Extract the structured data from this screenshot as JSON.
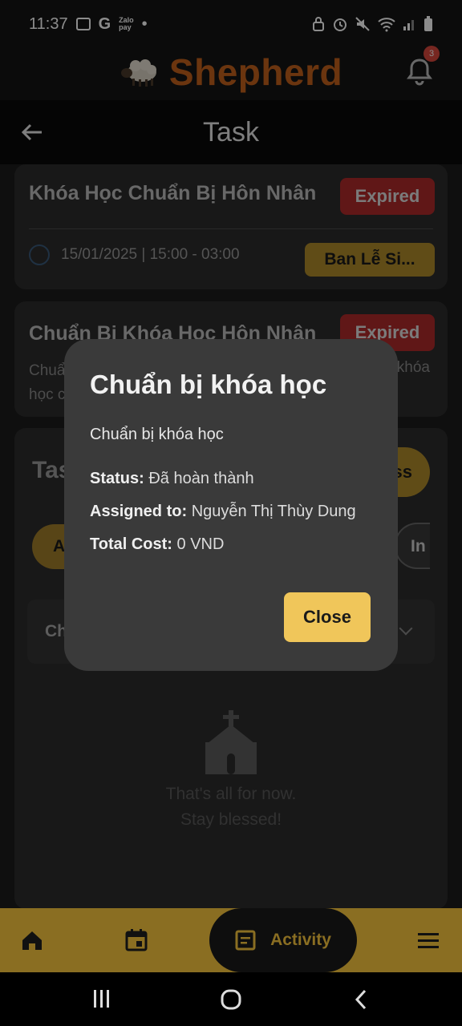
{
  "status_bar": {
    "time": "11:37",
    "zalo_line1": "Zalo",
    "zalo_line2": "pay"
  },
  "app": {
    "brand": "Shepherd",
    "notification_count": "3"
  },
  "header": {
    "title": "Task"
  },
  "cards": [
    {
      "title": "Khóa Học Chuẩn Bị Hôn Nhân",
      "status": "Expired",
      "date": "15/01/2025 | 15:00 - 03:00",
      "category": "Ban Lễ Si..."
    },
    {
      "title": "Chuẩn Bị Khóa Học Hôn Nhân",
      "status": "Expired",
      "description_left_1": "Chuẩ",
      "description_left_2": "học c",
      "description_right": "khóa"
    }
  ],
  "background_section": {
    "title_fragment": "Tas",
    "pill_fragment": "ss",
    "chip_left_fragment": "A",
    "chip_right_fragment": "In",
    "select_fragment": "Ch"
  },
  "empty_state": {
    "line1": "That's all for now.",
    "line2": "Stay blessed!"
  },
  "dialog": {
    "title": "Chuẩn bị khóa học",
    "subtitle": "Chuẩn bị khóa học",
    "status_label": "Status:",
    "status_value": "Đã hoàn thành",
    "assigned_label": "Assigned to:",
    "assigned_value": "Nguyễn Thị Thùy Dung",
    "cost_label": "Total Cost:",
    "cost_value": "0 VND",
    "close_label": "Close"
  },
  "bottom_nav": {
    "activity_label": "Activity"
  },
  "colors": {
    "brand": "#c4621c",
    "gold": "#f0c65a",
    "expired": "#b02a2a",
    "nav_bg": "#8a6e22"
  }
}
